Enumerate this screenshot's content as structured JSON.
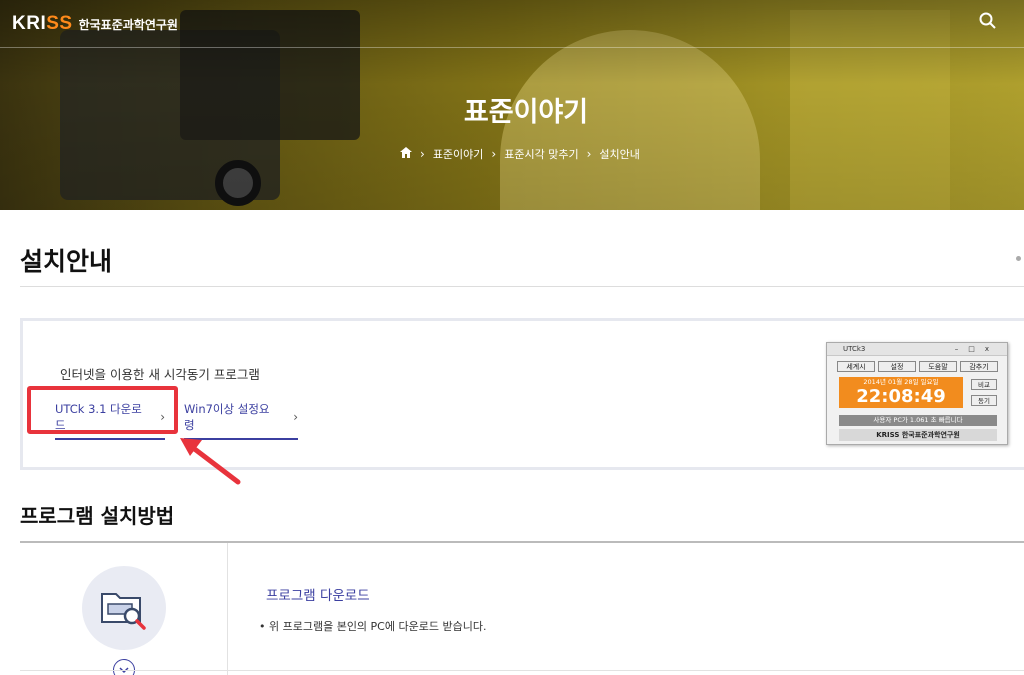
{
  "header": {
    "logo_left": "KRI",
    "logo_accent": "SS",
    "logo_sub": "한국표준과학연구원",
    "search_icon": "search-icon"
  },
  "hero": {
    "title": "표준이야기",
    "breadcrumb": [
      "표준이야기",
      "표준시각 맞추기",
      "설치안내"
    ],
    "home_icon": "home-icon"
  },
  "page": {
    "title": "설치안내"
  },
  "info": {
    "description": "인터넷을 이용한 새 시각동기 프로그램",
    "links": [
      {
        "label": "UTCk 3.1 다운로드"
      },
      {
        "label": "Win7이상 설정요령"
      }
    ]
  },
  "utck_window": {
    "title": "UTCk3",
    "buttons": [
      "세계시",
      "설정",
      "도움말",
      "감추기"
    ],
    "date": "2014년 01월 28일 일요일",
    "time": "22:08:49",
    "side_buttons": [
      "비교",
      "동기"
    ],
    "message": "사용자 PC가 1.061 초 빠릅니다",
    "footer": "KRISS 한국표준과학연구원"
  },
  "install": {
    "section_title": "프로그램 설치방법",
    "step_title": "프로그램 다운로드",
    "step_text": "• 위 프로그램을 본인의 PC에 다운로드 받습니다."
  },
  "colors": {
    "accent": "#3b3fa0",
    "highlight": "#e8333c",
    "clock": "#f28c1e"
  }
}
